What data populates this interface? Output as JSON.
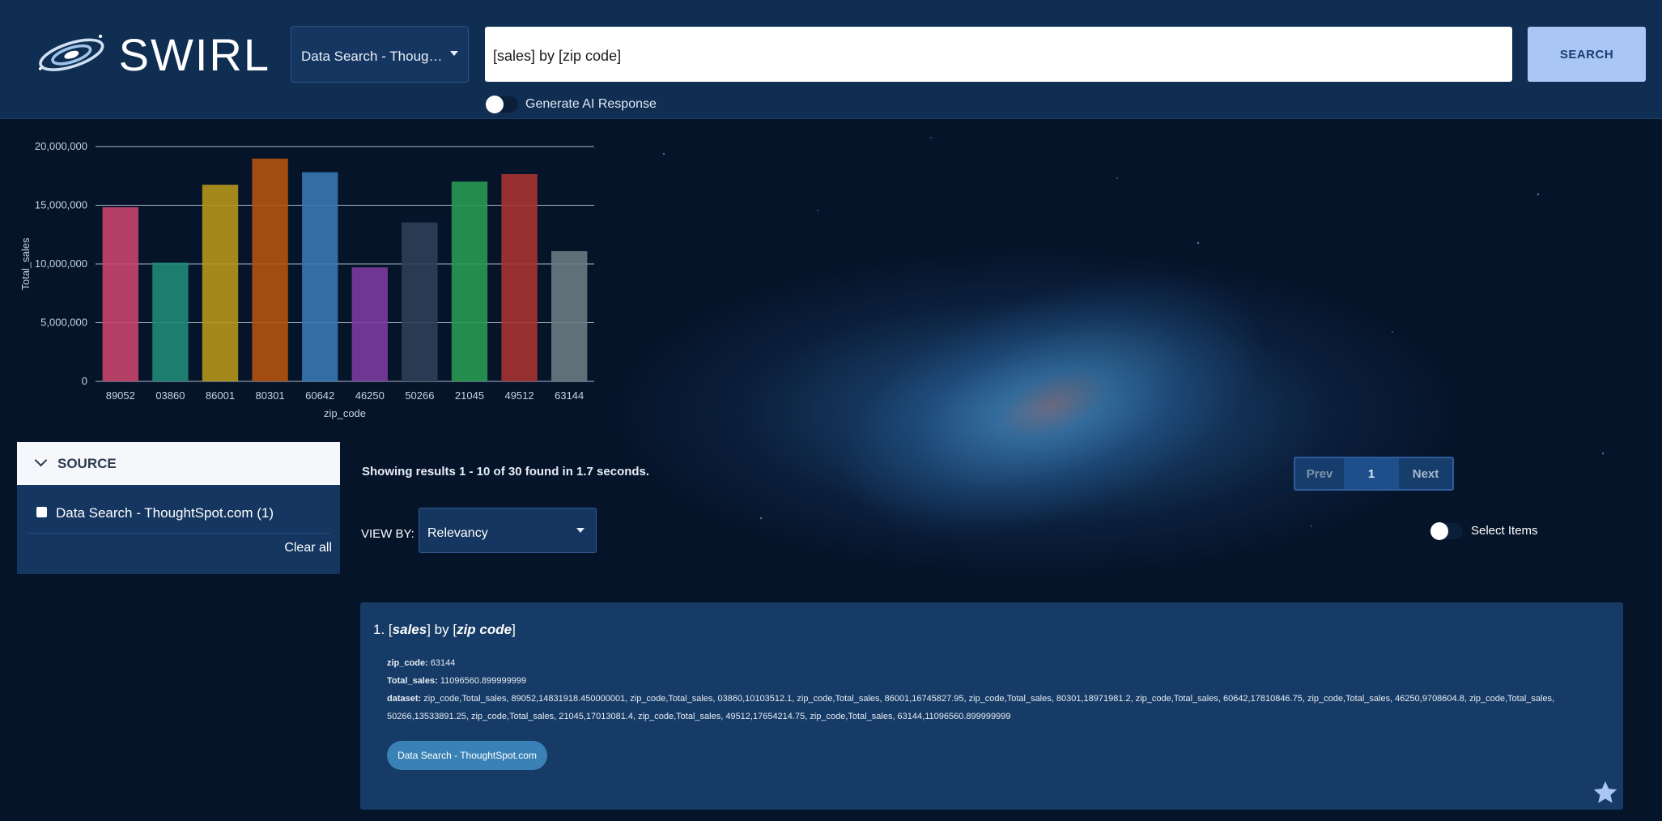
{
  "app": {
    "name": "SWIRL"
  },
  "search": {
    "source_selector_value": "Data Search - ThoughtSpot.com",
    "query": "[sales] by [zip code]",
    "button_label": "SEARCH",
    "ai_toggle_label": "Generate AI Response",
    "ai_toggle_on": false
  },
  "chart_data": {
    "type": "bar",
    "categories": [
      "89052",
      "03860",
      "86001",
      "80301",
      "60642",
      "46250",
      "50266",
      "21045",
      "49512",
      "63144"
    ],
    "values": [
      14831918.45,
      10103512.1,
      16745827.95,
      18971981.2,
      17810846.75,
      9708604.8,
      13533891.25,
      17013081.4,
      17654214.75,
      11096560.9
    ],
    "colors": [
      "#c6446e",
      "#1e8a75",
      "#b5961b",
      "#b4520e",
      "#3777b1",
      "#7b3b9f",
      "#2d3f56",
      "#289a52",
      "#a63332",
      "#6c7a81"
    ],
    "xlabel": "zip_code",
    "ylabel": "Total_sales",
    "ylim": [
      0,
      20000000
    ],
    "yticks": [
      "0",
      "5,000,000",
      "10,000,000",
      "15,000,000",
      "20,000,000"
    ],
    "grid": true
  },
  "facets": {
    "title": "SOURCE",
    "items": [
      {
        "label": "Data Search - ThoughtSpot.com (1)",
        "checked": false
      }
    ],
    "clear_label": "Clear all"
  },
  "results_info": "Showing results 1 - 10 of 30 found in 1.7 seconds.",
  "pagination": {
    "prev": "Prev",
    "current": "1",
    "next": "Next"
  },
  "view_by": {
    "label": "VIEW BY:",
    "value": "Relevancy"
  },
  "select_items": {
    "label": "Select Items",
    "on": false
  },
  "results": [
    {
      "index": "1.",
      "title_parts": [
        "[",
        "sales",
        "] by [",
        "zip code",
        "]"
      ],
      "fields": [
        {
          "key": "zip_code:",
          "value": "63144"
        },
        {
          "key": "Total_sales:",
          "value": "11096560.899999999"
        },
        {
          "key": "dataset:",
          "value": "zip_code,Total_sales, 89052,14831918.450000001, zip_code,Total_sales, 03860,10103512.1, zip_code,Total_sales, 86001,16745827.95, zip_code,Total_sales, 80301,18971981.2, zip_code,Total_sales, 60642,17810846.75, zip_code,Total_sales, 46250,9708604.8, zip_code,Total_sales, 50266,13533891.25, zip_code,Total_sales, 21045,17013081.4, zip_code,Total_sales, 49512,17654214.75, zip_code,Total_sales, 63144,11096560.899999999"
        }
      ],
      "source_tag": "Data Search - ThoughtSpot.com"
    }
  ],
  "icons": {
    "logo": "swirl-galaxy-logo",
    "chevron": "chevron-down-icon",
    "favorite": "star-icon"
  }
}
